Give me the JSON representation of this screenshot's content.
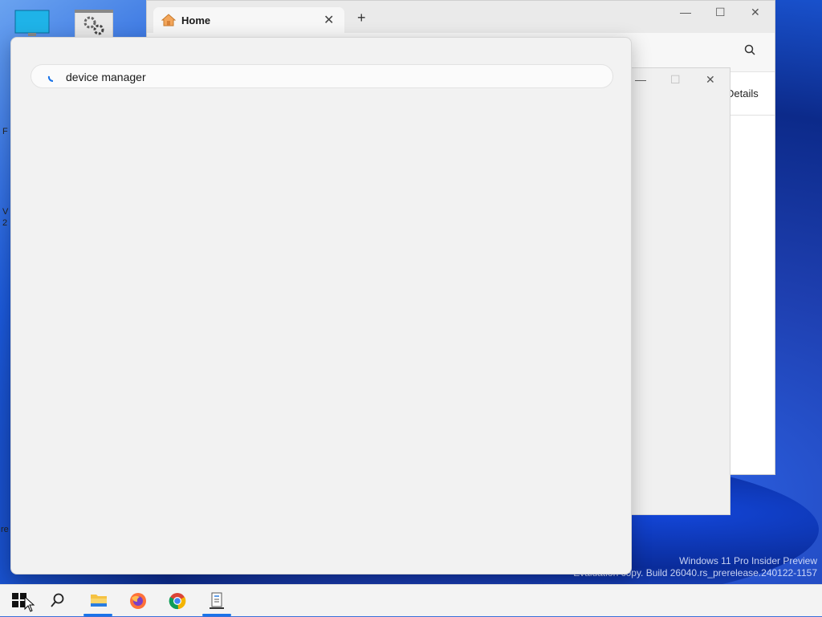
{
  "desktop": {
    "watermark_line1": "Windows 11 Pro Insider Preview",
    "watermark_line2": "Evaluation copy. Build 26040.rs_prerelease.240122-1157",
    "edge_letters": [
      "F",
      "V",
      "2",
      "re"
    ]
  },
  "explorer": {
    "tab_label": "Home",
    "tab_close": "✕",
    "new_tab": "+",
    "details_label": "Details"
  },
  "search": {
    "query": "device manager"
  },
  "taskbar": {
    "items": [
      "start",
      "search",
      "file-explorer",
      "firefox",
      "chrome",
      "app"
    ]
  },
  "colors": {
    "accent": "#1a73e8",
    "panel_bg": "#f2f2f2",
    "taskbar_bg": "#f3f3f3"
  }
}
